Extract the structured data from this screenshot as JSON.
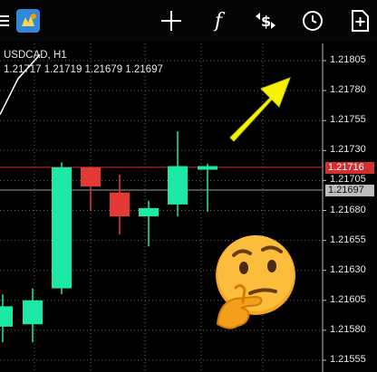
{
  "toolbar": {
    "menu_icon": "menu-icon",
    "logo_icon": "metatrader-logo-icon",
    "buttons": [
      {
        "name": "crosshair-button",
        "icon": "crosshair-icon"
      },
      {
        "name": "indicators-button",
        "icon": "function-icon",
        "glyph": "f"
      },
      {
        "name": "symbols-button",
        "icon": "dollar-arrows-icon",
        "glyph": "$"
      },
      {
        "name": "timeframe-button",
        "icon": "clock-icon"
      },
      {
        "name": "new-order-button",
        "icon": "add-order-icon"
      }
    ]
  },
  "chart": {
    "symbol": "USDCAD, H1",
    "ohlc": "1.21717 1.21719 1.21679 1.21697",
    "y_axis_labels": [
      "1.21805",
      "1.21780",
      "1.21755",
      "1.21730",
      "1.21705",
      "1.21680",
      "1.21655",
      "1.21630",
      "1.21605",
      "1.21580",
      "1.21555"
    ],
    "ask_price": "1.21716",
    "bid_price": "1.21697",
    "colors": {
      "bull": "#1de9a6",
      "bear": "#e53935",
      "wick_bull": "#1de9a6",
      "wick_bear": "#e53935",
      "grid": "#666666",
      "ask_line": "#d32f2f",
      "bid_line": "#9e9e9e",
      "arrow": "#f7f300"
    },
    "candles": [
      {
        "open": 1.21583,
        "high": 1.2161,
        "low": 1.2157,
        "close": 1.216
      },
      {
        "open": 1.21585,
        "high": 1.21615,
        "low": 1.2157,
        "close": 1.21605
      },
      {
        "open": 1.21615,
        "high": 1.2172,
        "low": 1.2161,
        "close": 1.21716
      },
      {
        "open": 1.21716,
        "high": 1.21716,
        "low": 1.2168,
        "close": 1.217
      },
      {
        "open": 1.21695,
        "high": 1.2171,
        "low": 1.2166,
        "close": 1.21675
      },
      {
        "open": 1.21675,
        "high": 1.21688,
        "low": 1.2165,
        "close": 1.21682
      },
      {
        "open": 1.21685,
        "high": 1.21746,
        "low": 1.21675,
        "close": 1.21717
      },
      {
        "open": 1.21714,
        "high": 1.21719,
        "low": 1.21679,
        "close": 1.21717
      }
    ],
    "indicator_line": [
      1.2176,
      1.2179,
      1.2181
    ]
  },
  "annotations": {
    "arrow_icon": "yellow-arrow-icon",
    "emoji_icon": "thinking-face-emoji-icon"
  }
}
